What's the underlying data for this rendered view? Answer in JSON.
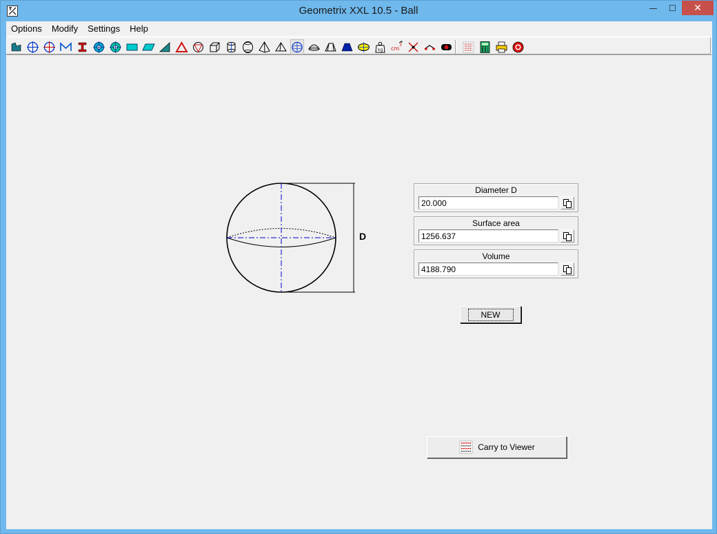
{
  "window": {
    "title": "Geometrix XXL 10.5 - Ball",
    "minimize_glyph": "—",
    "maximize_glyph": "☐",
    "close_glyph": "✕"
  },
  "menu": [
    "Options",
    "Modify",
    "Settings",
    "Help"
  ],
  "toolbar": {
    "icons": [
      "shape-icon",
      "circle-cross-icon",
      "circle-cross-red-icon",
      "zigzag-icon",
      "i-beam-icon",
      "circle-target-icon",
      "circle-target-green-icon",
      "rectangle-icon",
      "parallelogram-icon",
      "right-triangle-icon",
      "triangle-icon",
      "cone-circle-icon",
      "cube-icon",
      "cylinder-icon",
      "barrel-icon",
      "pyramid-icon",
      "pyramid-small-icon",
      "sphere-icon",
      "sphere-segment-icon",
      "truncated-pyramid-icon",
      "trapezoid-icon",
      "ellipsoid-icon",
      "weight-icon",
      "cm3-icon",
      "cross-arrows-icon",
      "pencil-icon",
      "bolt-icon",
      "viewer-list-icon",
      "calculator-icon",
      "printer-icon",
      "stop-icon"
    ],
    "active_index": 17
  },
  "drawing": {
    "dimension_label": "D"
  },
  "fields": [
    {
      "label": "Diameter D",
      "value": "20.000"
    },
    {
      "label": "Surface area",
      "value": "1256.637"
    },
    {
      "label": "Volume",
      "value": "4188.790"
    }
  ],
  "buttons": {
    "new_label": "NEW",
    "carry_label": "Carry to Viewer"
  },
  "colors": {
    "title_bar": "#6fb8ec",
    "close_button": "#c7504b",
    "axis_lines": "#0000cc"
  }
}
